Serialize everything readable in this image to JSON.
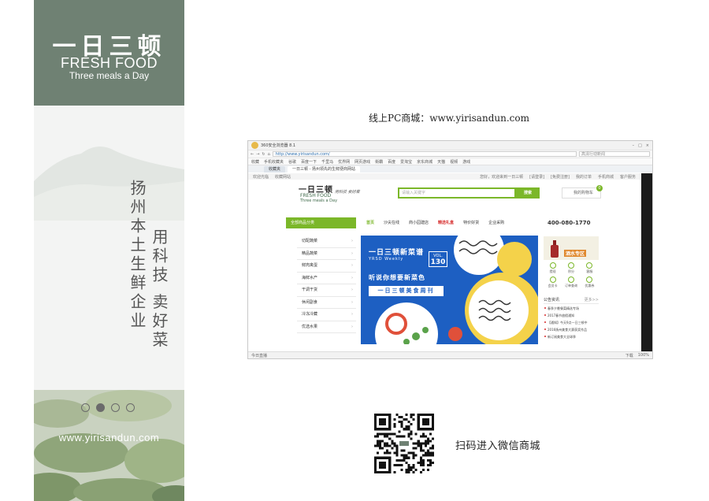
{
  "left_panel": {
    "brand_cn": "一日三顿",
    "brand_en": "FRESH FOOD",
    "brand_tagline": "Three meals a Day",
    "slogan_1": "扬州本土生鲜企业",
    "slogan_2": "用科技 卖好菜",
    "carousel": {
      "count": 4,
      "active_index": 1
    },
    "website": "www.yirisandun.com",
    "colors": {
      "header": "#6f8173",
      "panel": "#f3f4f3"
    }
  },
  "pc_caption": "线上PC商城：www.yirisandun.com",
  "browser": {
    "window_title": "360安全浏览器 8.1",
    "url": "http://www.yirisandun.com/",
    "search_placeholder": "高清行动新闻",
    "nav_buttons": [
      "←",
      "→",
      "↻",
      "⌂"
    ],
    "window_controls": [
      "–",
      "□",
      "×"
    ],
    "bookmarks": [
      "收藏",
      "手机收藏夹",
      "谷歌",
      "百度一下",
      "千里马",
      "优界网",
      "网页游戏",
      "街霸",
      "百度",
      "爱淘宝",
      "京东商城",
      "天猫",
      "视频",
      "游戏"
    ],
    "tabs": [
      "收藏夹",
      "一日三顿 - 扬州领先的生鲜便商网站"
    ],
    "status_left": "今日直播",
    "status_right": [
      "下载",
      "100%"
    ],
    "site": {
      "topbar_left": [
        "欢迎光临",
        "收藏网站"
      ],
      "topbar_right": [
        "您好，欢迎来到一日三顿",
        "[请登录]",
        "[免费注册]",
        "我的订单",
        "手机商城",
        "客户服务"
      ],
      "logo_cn": "一日三顿",
      "logo_en": "FRESH FOOD",
      "logo_tag": "Three meals a Day",
      "logo_slogan": "用科技 卖好菜",
      "search_placeholder": "请输入关键字",
      "search_button": "搜索",
      "cart_label": "我的购物车",
      "cart_count": "0",
      "category_header": "全部商品分类",
      "nav_links": [
        "首页",
        "沙尖在线",
        "商小园建店",
        "精选礼盒",
        "特价好货",
        "企业采购"
      ],
      "hotline": "400-080-1770",
      "categories": [
        "切配蔬菜",
        "精品蔬菜",
        "鲜肉禽蛋",
        "海鲜水产",
        "干调干货",
        "休闲副食",
        "冷冻冷藏",
        "优选水果"
      ],
      "banner": {
        "title": "一日三顿新菜谱",
        "subtitle": "YRSD Weekly",
        "vol_label": "VOL.",
        "vol_number": "130",
        "line1": "听说你想要新菜色",
        "line2": "一日三顿美食周刊"
      },
      "promo_label": "酒水专区",
      "services": [
        "提现",
        "积分",
        "客服",
        "会员卡",
        "订单查询",
        "优惠券"
      ],
      "news_title": "公告资讯",
      "news_more": "更多>>",
      "news": [
        "春季夕晚餐菜精选专场",
        "2017春节放假通知",
        "【通知】今天9点一日三顿中",
        "2016扬州美食大赛获奖作品",
        "新订阅美食大全球季"
      ],
      "accent": "#7bb729",
      "banner_color": "#1d5fc2"
    }
  },
  "wechat_caption": "扫码进入微信商城"
}
